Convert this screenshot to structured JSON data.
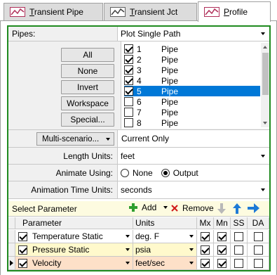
{
  "tabs": [
    {
      "label_pre": "",
      "label_u": "T",
      "label_post": "ransient Pipe",
      "icon": "line-chart-icon",
      "active": false
    },
    {
      "label_pre": "",
      "label_u": "T",
      "label_post": "ransient Jct",
      "icon": "line-chart-icon",
      "active": false
    },
    {
      "label_pre": "",
      "label_u": "P",
      "label_post": "rofile",
      "icon": "line-chart-icon",
      "active": true
    }
  ],
  "pipes": {
    "label": "Pipes:",
    "mode": "Plot Single Path"
  },
  "buttons": {
    "all": "All",
    "none": "None",
    "invert": "Invert",
    "workspace": "Workspace",
    "special": "Special..."
  },
  "pipe_list": [
    {
      "num": "1",
      "name": "Pipe",
      "checked": true,
      "selected": false
    },
    {
      "num": "2",
      "name": "Pipe",
      "checked": true,
      "selected": false
    },
    {
      "num": "3",
      "name": "Pipe",
      "checked": true,
      "selected": false
    },
    {
      "num": "4",
      "name": "Pipe",
      "checked": true,
      "selected": false
    },
    {
      "num": "5",
      "name": "Pipe",
      "checked": true,
      "selected": true
    },
    {
      "num": "6",
      "name": "Pipe",
      "checked": false,
      "selected": false
    },
    {
      "num": "7",
      "name": "Pipe",
      "checked": false,
      "selected": false
    },
    {
      "num": "8",
      "name": "Pipe",
      "checked": false,
      "selected": false
    }
  ],
  "scenario": {
    "button": "Multi-scenario...",
    "value": "Current Only"
  },
  "length_units": {
    "label": "Length Units:",
    "value": "feet"
  },
  "animate_using": {
    "label": "Animate Using:",
    "option_none": "None",
    "option_output": "Output",
    "selected": "Output"
  },
  "anim_time_units": {
    "label": "Animation Time Units:",
    "value": "seconds"
  },
  "select_param": {
    "label": "Select Parameter",
    "add": "Add",
    "remove": "Remove"
  },
  "param_table": {
    "headers": {
      "param": "Parameter",
      "units": "Units",
      "mx": "Mx",
      "mn": "Mn",
      "ss": "SS",
      "da": "DA"
    },
    "rows": [
      {
        "name": "Temperature Static",
        "units": "deg. F",
        "checked": true,
        "mx": true,
        "mn": true,
        "ss": false,
        "da": false,
        "color": "#ffffff",
        "current": false
      },
      {
        "name": "Pressure Static",
        "units": "psia",
        "checked": true,
        "mx": true,
        "mn": true,
        "ss": false,
        "da": false,
        "color": "#fff9cc",
        "current": false
      },
      {
        "name": "Velocity",
        "units": "feet/sec",
        "checked": true,
        "mx": true,
        "mn": true,
        "ss": false,
        "da": false,
        "color": "#fde0c8",
        "current": true
      }
    ]
  },
  "colors": {
    "frame": "#1f8a1f",
    "selection": "#0078d7",
    "tab_icon": "#b0305a",
    "add": "#2e9e2e",
    "remove": "#d01818",
    "arrow_blue": "#1e7ad6"
  }
}
